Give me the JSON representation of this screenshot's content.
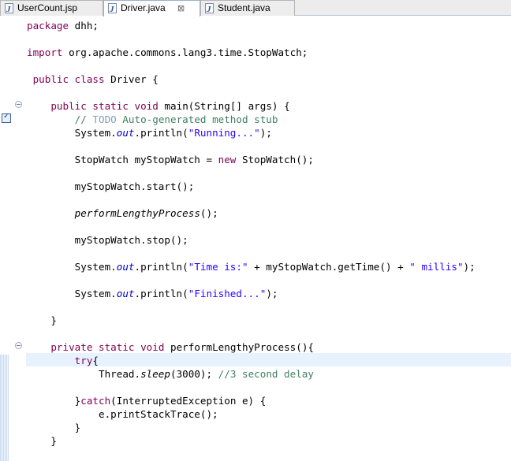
{
  "tabs": [
    {
      "label": "UserCount.jsp",
      "icon": "jsp-file-icon",
      "active": false
    },
    {
      "label": "Driver.java",
      "icon": "java-file-icon",
      "active": true,
      "close": "⊠"
    },
    {
      "label": "Student.java",
      "icon": "java-file-icon",
      "active": false
    }
  ],
  "colors": {
    "keyword": "#7f0055",
    "string": "#2a00ff",
    "comment": "#3f7f5f",
    "field": "#0000c0",
    "todo": "#7f9fbf",
    "current_line": "#e8f2fe"
  },
  "code": {
    "l1a": "package",
    "l1b": " dhh;",
    "l2a": "import",
    "l2b": " org.apache.commons.lang3.time.StopWatch;",
    "l3a": " public",
    "l3b": " ",
    "l3c": "class",
    "l3d": " Driver {",
    "l4a": "    public",
    "l4b": " ",
    "l4c": "static",
    "l4d": " ",
    "l4e": "void",
    "l4f": " main(String[] args) {",
    "l5a": "        // ",
    "l5b": "TODO",
    "l5c": " Auto-generated method stub",
    "l6a": "        System.",
    "l6b": "out",
    "l6c": ".println(",
    "l6d": "\"Running...\"",
    "l6e": ");",
    "l7a": "        StopWatch myStopWatch = ",
    "l7b": "new",
    "l7c": " StopWatch();",
    "l8": "        myStopWatch.start();",
    "l9a": "        ",
    "l9b": "performLengthyProcess",
    "l9c": "();",
    "l10": "        myStopWatch.stop();",
    "l11a": "        System.",
    "l11b": "out",
    "l11c": ".println(",
    "l11d": "\"Time is:\"",
    "l11e": " + myStopWatch.getTime() + ",
    "l11f": "\" millis\"",
    "l11g": ");",
    "l12a": "        System.",
    "l12b": "out",
    "l12c": ".println(",
    "l12d": "\"Finished...\"",
    "l12e": ");",
    "l13": "    }",
    "l14a": "    private",
    "l14b": " ",
    "l14c": "static",
    "l14d": " ",
    "l14e": "void",
    "l14f": " performLengthyProcess(){",
    "l15a": "        ",
    "l15b": "try",
    "l15c": "{",
    "l16a": "            Thread.",
    "l16b": "sleep",
    "l16c": "(3000); ",
    "l16d": "//3 second delay",
    "l17a": "        }",
    "l17b": "catch",
    "l17c": "(InterruptedException e) {",
    "l18": "            e.printStackTrace();",
    "l19": "        }",
    "l20": "    }"
  }
}
